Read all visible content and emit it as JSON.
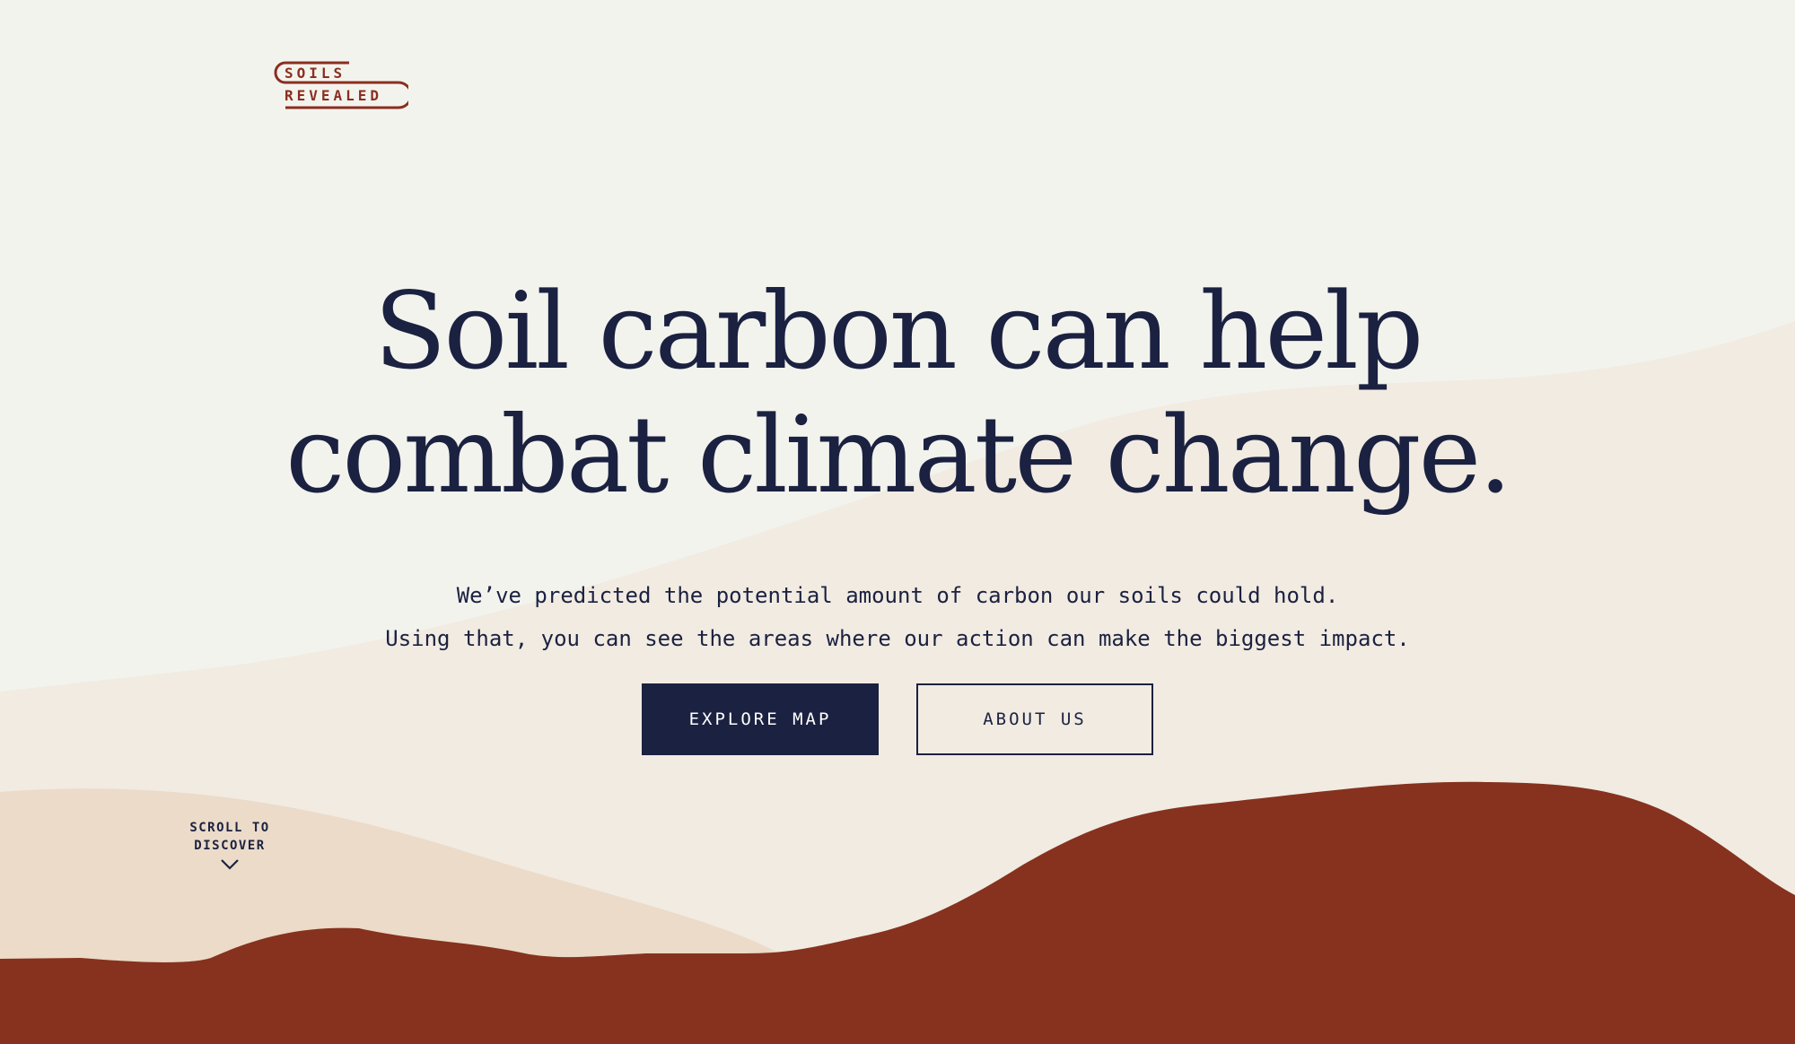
{
  "brand": {
    "logo_line1": "SOILS",
    "logo_line2": "REVEALED",
    "logo_color": "#8b2e1f"
  },
  "hero": {
    "headline_line1": "Soil carbon can help",
    "headline_line2": "combat climate change.",
    "subtitle_line1": "We’ve predicted the potential amount of carbon our soils could hold.",
    "subtitle_line2": "Using that, you can see the areas where our action can make the biggest impact."
  },
  "actions": {
    "explore_label": "EXPLORE MAP",
    "about_label": "ABOUT US"
  },
  "scroll": {
    "line1": "SCROLL TO",
    "line2": "DISCOVER",
    "icon": "chevron-down-icon"
  },
  "colors": {
    "background": "#f3f3ee",
    "navy": "#1b2140",
    "rust": "#86321e",
    "sand_light": "#f1ebe2",
    "sand": "#ebdbc8"
  }
}
